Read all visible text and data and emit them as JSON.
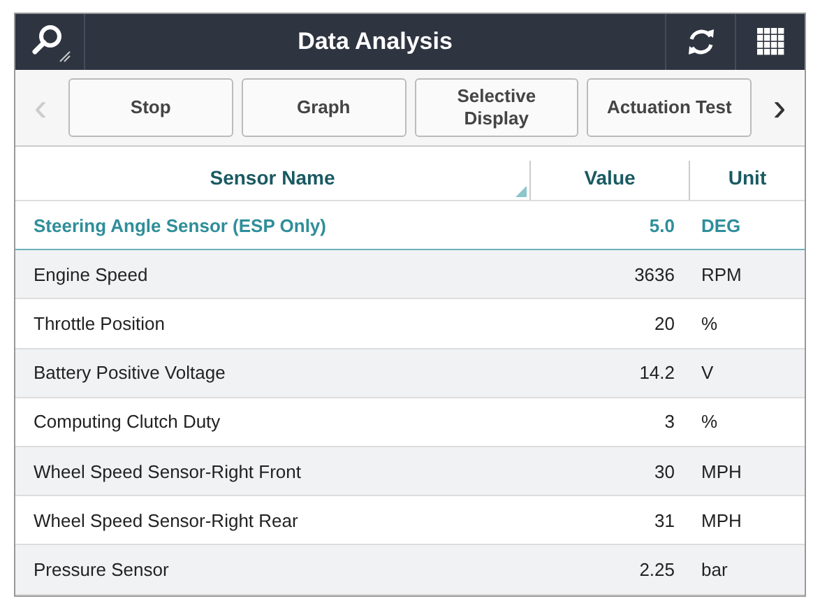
{
  "window": {
    "title": "Data Analysis"
  },
  "toolbar": {
    "buttons": [
      "Stop",
      "Graph",
      "Selective\nDisplay",
      "Actuation Test"
    ],
    "prev": "‹",
    "next": "›",
    "prev_disabled": true
  },
  "table": {
    "columns": [
      "Sensor Name",
      "Value",
      "Unit"
    ],
    "rows": [
      {
        "name": "Steering Angle Sensor (ESP Only)",
        "value": "5.0",
        "unit": "DEG",
        "selected": true
      },
      {
        "name": "Engine Speed",
        "value": "3636",
        "unit": "RPM",
        "selected": false
      },
      {
        "name": "Throttle Position",
        "value": "20",
        "unit": "%",
        "selected": false
      },
      {
        "name": "Battery Positive Voltage",
        "value": "14.2",
        "unit": "V",
        "selected": false
      },
      {
        "name": "Computing Clutch Duty",
        "value": "3",
        "unit": "%",
        "selected": false
      },
      {
        "name": "Wheel Speed Sensor-Right Front",
        "value": "30",
        "unit": "MPH",
        "selected": false
      },
      {
        "name": "Wheel Speed Sensor-Right Rear",
        "value": "31",
        "unit": "MPH",
        "selected": false
      },
      {
        "name": "Pressure Sensor",
        "value": "2.25",
        "unit": "bar",
        "selected": false
      }
    ]
  }
}
